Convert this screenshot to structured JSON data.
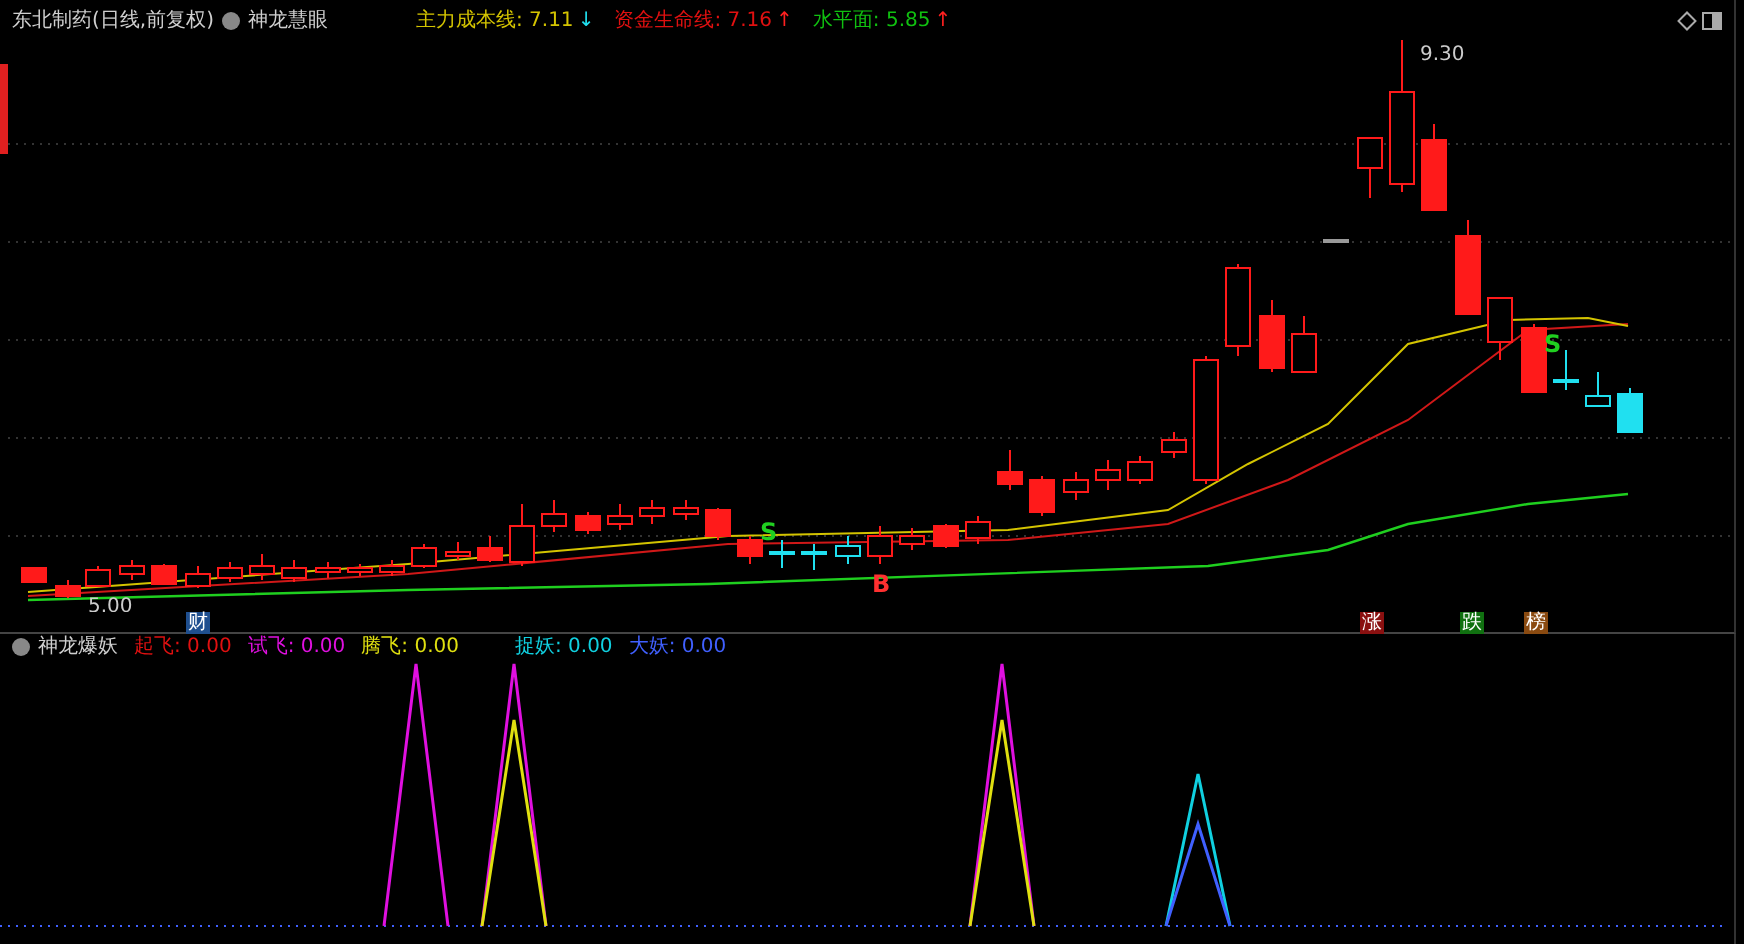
{
  "header": {
    "title": "东北制药(日线,前复权)",
    "indicator": "神龙慧眼",
    "lines": [
      {
        "label": "主力成本线: 7.11",
        "arrow": "↓",
        "rising": false,
        "color": "#d4c400"
      },
      {
        "label": "资金生命线: 7.16",
        "arrow": "↑",
        "rising": true,
        "color": "#e01010"
      },
      {
        "label": "水平面: 5.85",
        "arrow": "↑",
        "rising": true,
        "color": "#10c010"
      }
    ]
  },
  "main_chart": {
    "high_label": "9.30",
    "low_label": "5.00",
    "signals": [
      {
        "text": "S",
        "kind": "sell"
      },
      {
        "text": "S",
        "kind": "sell"
      },
      {
        "text": "B",
        "kind": "buy"
      }
    ],
    "tags": [
      {
        "text": "财",
        "color": "#1f4f8f"
      },
      {
        "text": "涨",
        "color": "#8a1010"
      },
      {
        "text": "跌",
        "color": "#107010"
      },
      {
        "text": "榜",
        "color": "#8a4a10"
      }
    ]
  },
  "lower_panel": {
    "title": "神龙爆妖",
    "values": [
      {
        "label": "起飞: 0.00",
        "color": "#e01010"
      },
      {
        "label": "试飞: 0.00",
        "color": "#e010e0"
      },
      {
        "label": "腾飞: 0.00",
        "color": "#e0e010"
      },
      {
        "label": "捉妖: 0.00",
        "color": "#10d0e0"
      },
      {
        "label": "大妖: 0.00",
        "color": "#4060ff"
      }
    ]
  }
}
